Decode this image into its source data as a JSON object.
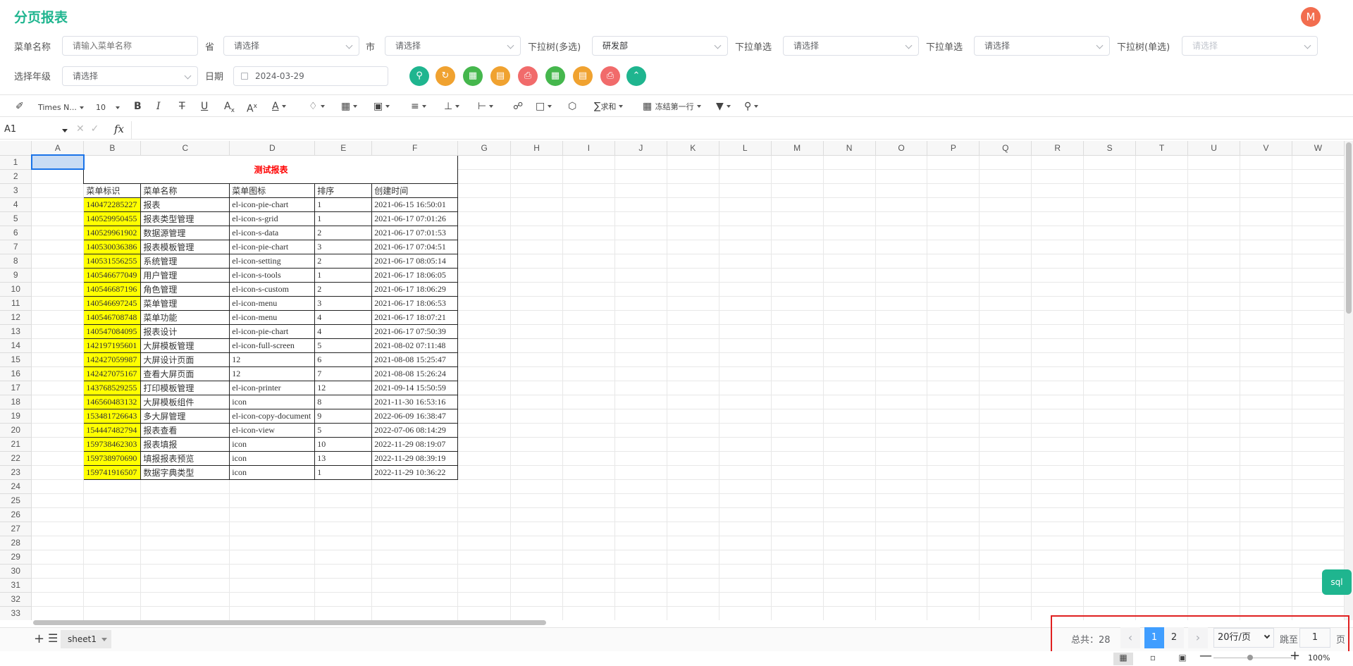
{
  "app": {
    "title": "分页报表",
    "avatar_letter": "M",
    "accent": "#1fb58f"
  },
  "filters": {
    "menu_name": {
      "label": "菜单名称",
      "placeholder": "请输入菜单名称"
    },
    "province": {
      "label": "省",
      "value": "请选择"
    },
    "city": {
      "label": "市",
      "value": "请选择"
    },
    "tree_multi": {
      "label": "下拉树(多选)",
      "value": "研发部"
    },
    "single_1": {
      "label": "下拉单选",
      "value": "请选择"
    },
    "single_2": {
      "label": "下拉单选",
      "value": "请选择"
    },
    "tree_single": {
      "label": "下拉树(单选)",
      "value": "请选择"
    },
    "grade": {
      "label": "选择年级",
      "value": "请选择"
    },
    "date": {
      "label": "日期",
      "value": "2024-03-29"
    }
  },
  "action_buttons": [
    {
      "icon": "search-icon",
      "color": "#1fb58f"
    },
    {
      "icon": "reset-icon",
      "color": "#f0a230"
    },
    {
      "icon": "excel-export-icon",
      "color": "#45b74d"
    },
    {
      "icon": "pdf-export-icon",
      "color": "#f0a230"
    },
    {
      "icon": "print-icon",
      "color": "#f16b6b"
    },
    {
      "icon": "excel-export-all-icon",
      "color": "#45b74d"
    },
    {
      "icon": "pdf-export-all-icon",
      "color": "#f0a230"
    },
    {
      "icon": "print-all-icon",
      "color": "#f16b6b"
    },
    {
      "icon": "collapse-icon",
      "color": "#1fb58f"
    }
  ],
  "toolbar": {
    "font_family": "Times N...",
    "font_size": "10",
    "sum_label": "求和",
    "freeze_label": "冻结第一行"
  },
  "formula": {
    "cell_ref": "A1",
    "fx": "fx"
  },
  "columns": [
    "A",
    "B",
    "C",
    "D",
    "E",
    "F",
    "G",
    "H",
    "I",
    "J",
    "K",
    "L",
    "M",
    "N",
    "O",
    "P",
    "Q",
    "R",
    "S",
    "T",
    "U",
    "V",
    "W"
  ],
  "report": {
    "title": "测试报表",
    "headers": [
      "菜单标识",
      "菜单名称",
      "菜单图标",
      "排序",
      "创建时间"
    ],
    "rows": [
      [
        "140472285227",
        "报表",
        "el-icon-pie-chart",
        "1",
        "2021-06-15 16:50:01"
      ],
      [
        "140529950455",
        "报表类型管理",
        "el-icon-s-grid",
        "1",
        "2021-06-17 07:01:26"
      ],
      [
        "140529961902",
        "数据源管理",
        "el-icon-s-data",
        "2",
        "2021-06-17 07:01:53"
      ],
      [
        "140530036386",
        "报表模板管理",
        "el-icon-pie-chart",
        "3",
        "2021-06-17 07:04:51"
      ],
      [
        "140531556255",
        "系统管理",
        "el-icon-setting",
        "2",
        "2021-06-17 08:05:14"
      ],
      [
        "140546677049",
        "用户管理",
        "el-icon-s-tools",
        "1",
        "2021-06-17 18:06:05"
      ],
      [
        "140546687196",
        "角色管理",
        "el-icon-s-custom",
        "2",
        "2021-06-17 18:06:29"
      ],
      [
        "140546697245",
        "菜单管理",
        "el-icon-menu",
        "3",
        "2021-06-17 18:06:53"
      ],
      [
        "140546708748",
        "菜单功能",
        "el-icon-menu",
        "4",
        "2021-06-17 18:07:21"
      ],
      [
        "140547084095",
        "报表设计",
        "el-icon-pie-chart",
        "4",
        "2021-06-17 07:50:39"
      ],
      [
        "142197195601",
        "大屏模板管理",
        "el-icon-full-screen",
        "5",
        "2021-08-02 07:11:48"
      ],
      [
        "142427059987",
        "大屏设计页面",
        "12",
        "6",
        "2021-08-08 15:25:47"
      ],
      [
        "142427075167",
        "查看大屏页面",
        "12",
        "7",
        "2021-08-08 15:26:24"
      ],
      [
        "143768529255",
        "打印模板管理",
        "el-icon-printer",
        "12",
        "2021-09-14 15:50:59"
      ],
      [
        "146560483132",
        "大屏模板组件",
        "icon",
        "8",
        "2021-11-30 16:53:16"
      ],
      [
        "153481726643",
        "多大屏管理",
        "el-icon-copy-document",
        "9",
        "2022-06-09 16:38:47"
      ],
      [
        "154447482794",
        "报表查看",
        "el-icon-view",
        "5",
        "2022-07-06 08:14:29"
      ],
      [
        "159738462303",
        "报表填报",
        "icon",
        "10",
        "2022-11-29 08:19:07"
      ],
      [
        "159738970690",
        "填报报表预览",
        "icon",
        "13",
        "2022-11-29 08:39:19"
      ],
      [
        "159741916507",
        "数据字典类型",
        "icon",
        "1",
        "2022-11-29 10:36:22"
      ]
    ]
  },
  "sheet": {
    "tab_name": "sheet1"
  },
  "pagination": {
    "total_label": "总共：28",
    "pages": [
      "1",
      "2"
    ],
    "active_page": "1",
    "page_size": "20行/页",
    "jump_label": "跳至",
    "jump_value": "1",
    "page_suffix": "页"
  },
  "sql_button": "sql",
  "zoom": {
    "value": "100%",
    "level": 0.5
  }
}
